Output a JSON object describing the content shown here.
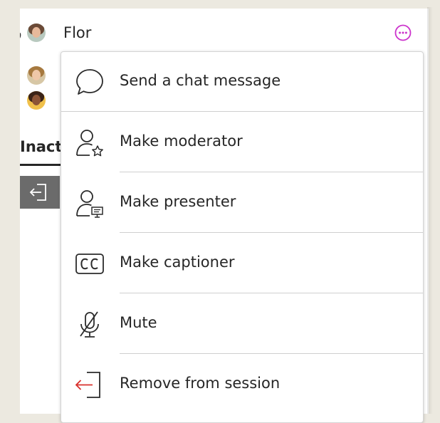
{
  "participants": {
    "active": [
      {
        "name": "Flor"
      }
    ],
    "inactive_heading": "Inact"
  },
  "menu": {
    "items": [
      {
        "label": "Send a chat message",
        "icon": "chat-bubble-icon"
      },
      {
        "label": "Make moderator",
        "icon": "user-star-icon"
      },
      {
        "label": "Make presenter",
        "icon": "user-presentation-icon"
      },
      {
        "label": "Make captioner",
        "icon": "closed-caption-icon"
      },
      {
        "label": "Mute",
        "icon": "microphone-muted-icon"
      },
      {
        "label": "Remove from session",
        "icon": "exit-door-icon"
      }
    ]
  },
  "colors": {
    "accent": "#cc33cc",
    "remove": "#d9302c",
    "tile": "#6b6b6b"
  }
}
